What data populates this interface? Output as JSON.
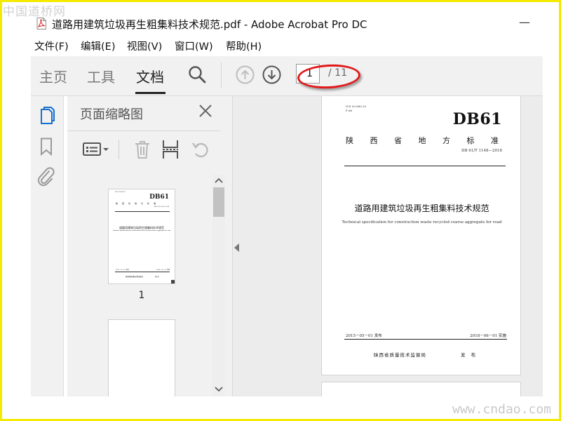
{
  "watermark_top": "中国道桥网",
  "watermark_bottom": "www.cndao.com",
  "window": {
    "title": "道路用建筑垃圾再生粗集料技术规范.pdf - Adobe Acrobat Pro DC",
    "minimize_glyph": "—"
  },
  "menu": [
    "文件(F)",
    "编辑(E)",
    "视图(V)",
    "窗口(W)",
    "帮助(H)"
  ],
  "toolbar": {
    "tabs": [
      "主页",
      "工具",
      "文档"
    ],
    "active_tab": "文档",
    "page_current": "1",
    "page_total": "/ 11",
    "annotation_color": "#e11a1a"
  },
  "side_icons": [
    "pages-icon",
    "bookmark-icon",
    "attachment-icon"
  ],
  "accent_color": "#1a6fc9",
  "nav_panel": {
    "title": "页面缩略图",
    "tool_icons": [
      "thumbnail-options-icon",
      "delete-icon",
      "crop-icon",
      "rotate-icon"
    ],
    "thumbnails": [
      {
        "label": "1"
      }
    ]
  },
  "document": {
    "ics": "ICS 93.080.20",
    "ccs": "P 66",
    "db_code": "DB61",
    "standard_type": [
      "陕",
      "西",
      "省",
      "地",
      "方",
      "标",
      "准"
    ],
    "standard_no": "DB 61/T 1148—2018",
    "title_cn": "道路用建筑垃圾再生粗集料技术规范",
    "title_en": "Technical specification for construction waste recycled coarse aggregate for road",
    "publish_date": "2015－05－01 发布",
    "implement_date": "2018－06－01 实施",
    "issuer": "陕西省质量技术监督局",
    "issue_word": "发 布"
  }
}
